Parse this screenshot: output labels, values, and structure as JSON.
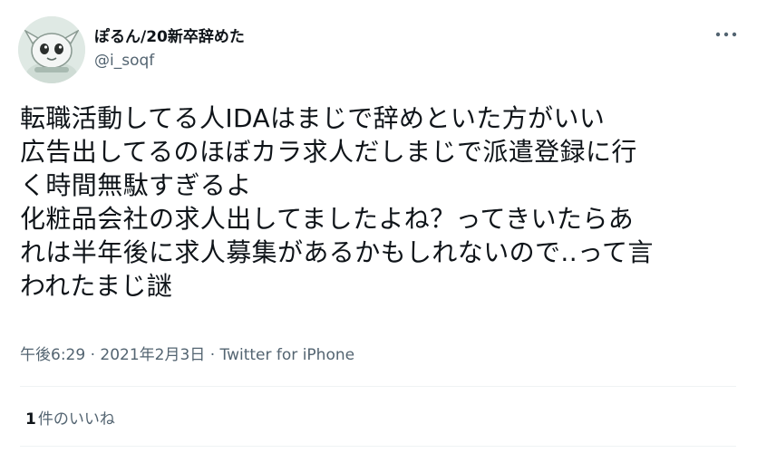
{
  "author": {
    "display_name": "ぽるん/20新卒辞めた",
    "handle": "@i_soqf",
    "avatar_icon": "cartoon-avatar-icon"
  },
  "more_icon": "more-options-icon",
  "tweet": {
    "lines": [
      "転職活動してる人IDAはまじで辞めといた方がいい",
      "広告出してるのほぼカラ求人だしまじで派遣登録に行",
      "く時間無駄すぎるよ",
      "化粧品会社の求人出してましたよね？ってきいたらあ",
      "れは半年後に求人募集があるかもしれないので..って言",
      "われたまじ謎"
    ]
  },
  "meta": {
    "time": "午後6:29",
    "separator": " · ",
    "date": "2021年2月3日",
    "separator2": " · ",
    "source": "Twitter for iPhone"
  },
  "likes": {
    "count": "1",
    "label": "件のいいね"
  },
  "colors": {
    "text": "#0f1419",
    "secondary": "#536471",
    "divider": "#eff3f4"
  }
}
